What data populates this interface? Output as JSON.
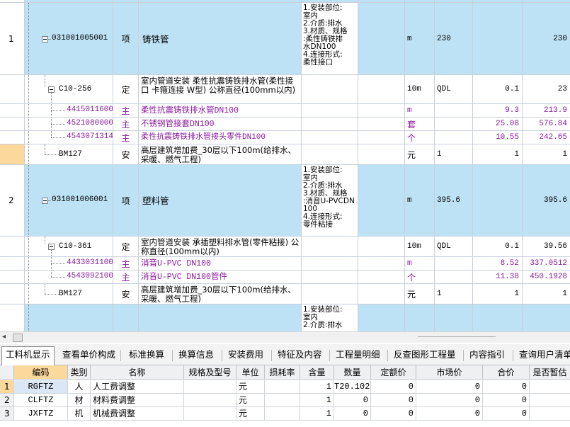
{
  "top_grid": {
    "rows": [
      {
        "id": "r_top",
        "num": "",
        "code": "",
        "type": "",
        "name": "",
        "unit": "",
        "qty": "",
        "v1": "",
        "v2": ""
      },
      {
        "id": "r1",
        "num": "1",
        "code": "031001005001",
        "type": "项",
        "name": "铸铁管",
        "features": "1.安装部位:\n室内\n2.介质:排水\n3.材质、规格\n:柔性铸铁排\n水DN100\n4.连接形式:\n柔性接口",
        "unit": "m",
        "qty": "230",
        "v1": "",
        "v2": "230"
      },
      {
        "id": "r2",
        "num": "",
        "code": "C10-256",
        "type": "定",
        "name": "室内管道安装 柔性抗震铸铁排水管(柔性接口 卡箍连接 W型) 公称直径(100mm以内)",
        "unit": "10m",
        "qty": "QDL",
        "v1": "0.1",
        "v2": "23"
      },
      {
        "id": "r3",
        "num": "",
        "code": "4415011600",
        "type": "主",
        "name": "柔性抗震铸铁排水管DN100",
        "unit": "m",
        "qty": "",
        "v1": "9.3",
        "v2": "213.9"
      },
      {
        "id": "r4",
        "num": "",
        "code": "4521080000",
        "type": "主",
        "name": "不锈钢管接套DN100",
        "unit": "套",
        "qty": "",
        "v1": "25.08",
        "v2": "576.84"
      },
      {
        "id": "r5",
        "num": "",
        "code": "4543071314",
        "type": "主",
        "name": "柔性抗震铸铁排水管接头零件DN100",
        "unit": "个",
        "qty": "",
        "v1": "10.55",
        "v2": "242.65"
      },
      {
        "id": "r6",
        "num": "",
        "code": "BM127",
        "type": "安",
        "name": "高层建筑增加费_30层以下100m(给排水、采暖、燃气工程)",
        "unit": "元",
        "qty": "1",
        "v1": "1",
        "v2": "1"
      },
      {
        "id": "r7",
        "num": "2",
        "code": "031001006001",
        "type": "项",
        "name": "塑料管",
        "features": "1.安装部位:\n室内\n2.介质:排水\n3.材质、规格\n:消音U-PVCDN\n100\n4.连接形式:\n零件粘接",
        "unit": "m",
        "qty": "395.6",
        "v1": "",
        "v2": "395.6"
      },
      {
        "id": "r8",
        "num": "",
        "code": "C10-361",
        "type": "定",
        "name": "室内管道安装 承插塑料排水管(零件粘接) 公称直径(100mm以内)",
        "unit": "10m",
        "qty": "QDL",
        "v1": "0.1",
        "v2": "39.56"
      },
      {
        "id": "r9",
        "num": "",
        "code": "4433031100",
        "type": "主",
        "name": "消音U-PVC DN100",
        "unit": "m",
        "qty": "",
        "v1": "8.52",
        "v2": "337.0512"
      },
      {
        "id": "r10",
        "num": "",
        "code": "4543092100",
        "type": "主",
        "name": "消音U-PVC DN100管件",
        "unit": "个",
        "qty": "",
        "v1": "11.38",
        "v2": "450.1928"
      },
      {
        "id": "r11",
        "num": "",
        "code": "BM127",
        "type": "安",
        "name": "高层建筑增加费_30层以下100m(给排水、采暖、燃气工程)",
        "unit": "元",
        "qty": "1",
        "v1": "1",
        "v2": "1"
      },
      {
        "id": "r12",
        "num": "",
        "code": "",
        "type": "",
        "name": "",
        "features": "1.安装部位:\n室内\n2.介质:排水",
        "unit": "",
        "qty": "",
        "v1": "",
        "v2": ""
      }
    ]
  },
  "scrollbar": {
    "left_arrow": "◂"
  },
  "tabs": [
    "工料机显示",
    "查看单价构成",
    "标准换算",
    "换算信息",
    "安装费用",
    "特征及内容",
    "工程量明细",
    "反查图形工程量",
    "内容指引",
    "查询用户清单"
  ],
  "bottom_grid": {
    "headers": [
      "编码",
      "类别",
      "名称",
      "规格及型号",
      "单位",
      "损耗率",
      "含量",
      "数量",
      "定额价",
      "市场价",
      "合价",
      "是否暂估"
    ],
    "rows": [
      {
        "num": "1",
        "code": "RGFTZ",
        "type": "人",
        "name": "人工费调整",
        "spec": "",
        "unit": "元",
        "loss": "",
        "content": "1",
        "qty": "T20.102",
        "price": "0",
        "market": "0",
        "total": "0",
        "temp": ""
      },
      {
        "num": "2",
        "code": "CLFTZ",
        "type": "材",
        "name": "材料费调整",
        "spec": "",
        "unit": "元",
        "loss": "",
        "content": "1",
        "qty": "0",
        "price": "0",
        "market": "0",
        "total": "0",
        "temp": ""
      },
      {
        "num": "3",
        "code": "JXFTZ",
        "type": "机",
        "name": "机械费调整",
        "spec": "",
        "unit": "元",
        "loss": "",
        "content": "1",
        "qty": "0",
        "price": "0",
        "market": "0",
        "total": "0",
        "temp": ""
      }
    ]
  },
  "colors": {
    "row_blue": "#bde2f5",
    "row_selected": "#fbd89c",
    "material_text": "#8b1a9e"
  }
}
